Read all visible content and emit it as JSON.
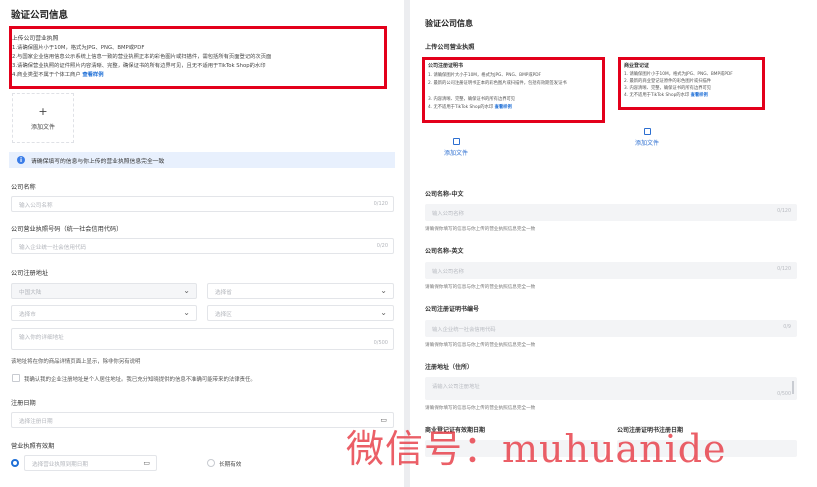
{
  "left": {
    "title": "验证公司信息",
    "upload": {
      "title": "上传公司营业执照",
      "requirements": [
        "1.请确保图片小于10M，格式为JPG、PNG、BMP或PDF",
        "2.与国家企业信用信息公示系统上信息一致的营业执照正本的彩色图片或扫描件，需包括所有页面登记的次页面",
        "3.请确保营业执照的证件照片内容清晰、完整，确保证书的所有边界可见，且无不适用于TikTok Shop的水印",
        "4.商业类型不属于个体工商户"
      ],
      "example_link": "查看样例",
      "add_label": "添加文件"
    },
    "info_text": "请确保填写的信息与你上传的营业执照信息完全一致",
    "company_name": {
      "label": "公司名称",
      "placeholder": "输入公司名称",
      "count": "0/120"
    },
    "credit_code": {
      "label": "公司营业执照号码（统一社会信用代码）",
      "placeholder": "输入企业统一社会信用代码",
      "count": "0/20"
    },
    "address": {
      "label": "公司注册地址",
      "country": "中国大陆",
      "province": "选择省",
      "city": "选择市",
      "district": "选择区",
      "detail_placeholder": "输入你的详细地址",
      "detail_count": "0/500",
      "note": "该地址将在你的商品详情页面上显示，除非你另有说明",
      "checkbox_label": "我确认我的企业注册地址是个人居住地址。我已充分知晓提供的信息不准确可能带来的法律责任。"
    },
    "reg_date": {
      "label": "注册日期",
      "placeholder": "选择注册日期"
    },
    "validity": {
      "label": "营业执照有效期",
      "placeholder": "选择营业执照到期日期",
      "long_term_label": "长期有效"
    }
  },
  "right": {
    "title": "验证公司信息",
    "upload_title": "上传公司营业执照",
    "cert": {
      "title": "公司注册证明书",
      "requirements": [
        "1. 请确保图片大小于10M，格式为JPG、PNG、BMP或PDF",
        "2. 最新的公司注册证明书正本的彩色图片或扫描件，包括有效期签发证书",
        "3. 内容清晰、完整，确保证书的所有边界可见",
        "4. 无不适用于TikTok Shop的水印"
      ],
      "example_link": "查看样例",
      "add_label": "添加文件"
    },
    "biz_reg": {
      "title": "商业登记证",
      "requirements": [
        "1. 请确保图片小于10M，格式为JPG、PNG、BMP或PDF",
        "2. 最新的商业登记证原件的彩色图片或扫描件",
        "3. 内容清晰、完整，确保证书的所有边界可见",
        "4. 无不适用于TikTok Shop的水印"
      ],
      "example_link": "查看样例",
      "add_label": "添加文件"
    },
    "name_cn": {
      "label": "公司名称-中文",
      "placeholder": "输入公司名称",
      "count": "0/120",
      "hint": "请确保你填写的信息与你上传的营业执照信息完全一致"
    },
    "name_en": {
      "label": "公司名称-英文",
      "placeholder": "输入公司名称",
      "count": "0/120",
      "hint": "请确保你填写的信息与你上传的营业执照信息完全一致"
    },
    "cert_no": {
      "label": "公司注册证明书编号",
      "placeholder": "输入企业统一社会信用代码",
      "count": "0/9",
      "hint": "请确保你填写的信息与你上传的营业执照信息完全一致"
    },
    "address": {
      "label": "注册地址（住所）",
      "placeholder": "请输入公司注册地址",
      "count": "0/500",
      "hint": "请确保你填写的信息与你上传的营业执照信息完全一致"
    },
    "biz_reg_expiry": {
      "label": "商业登记证有效期日期"
    },
    "cert_reg_date": {
      "label": "公司注册证明书注册日期"
    }
  },
  "watermark": "微信号：muhuanide"
}
